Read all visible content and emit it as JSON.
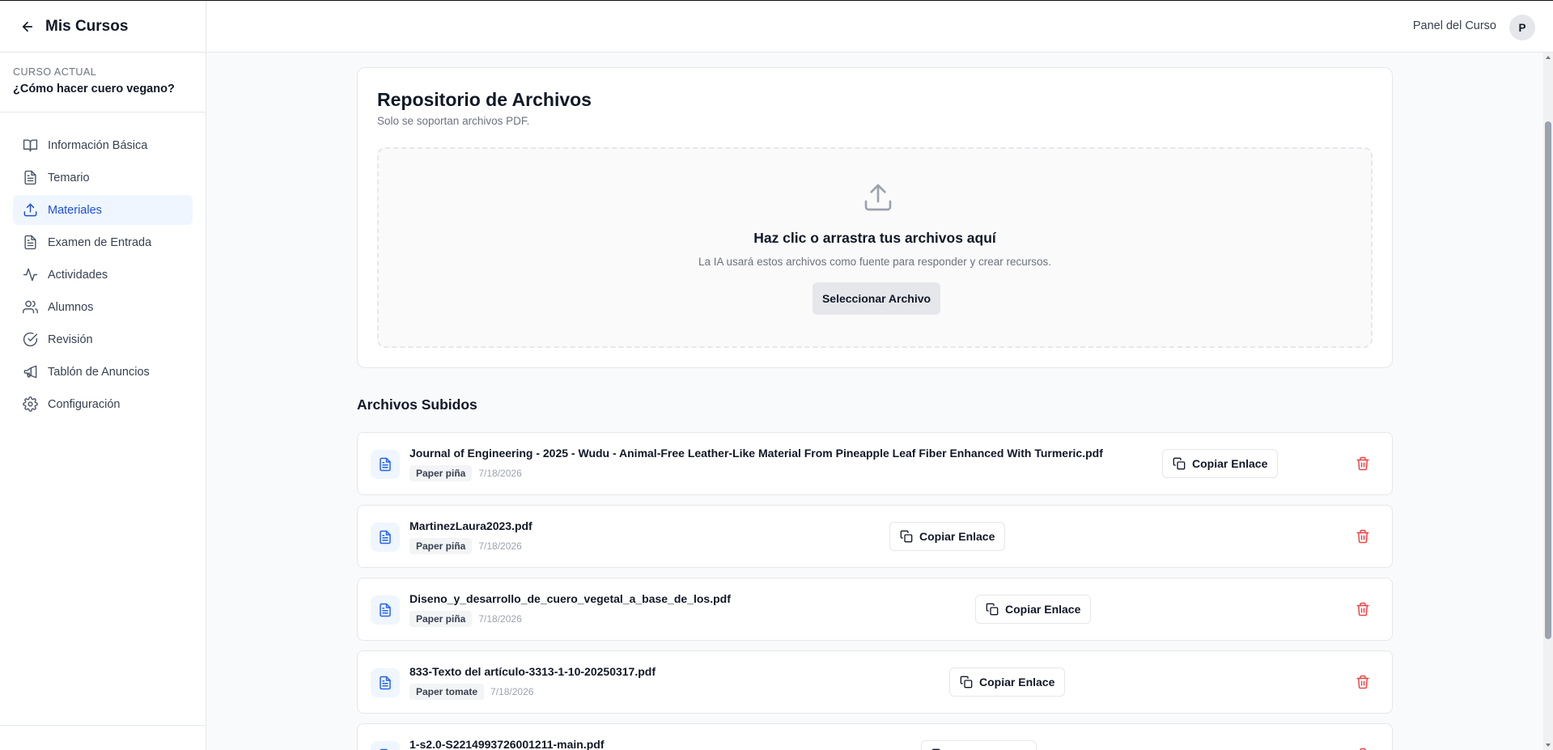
{
  "sidebar": {
    "title": "Mis Cursos",
    "course_label": "CURSO ACTUAL",
    "course_name": "¿Cómo hacer cuero vegano?",
    "items": [
      {
        "label": "Información Básica",
        "icon": "book-open-icon"
      },
      {
        "label": "Temario",
        "icon": "document-icon"
      },
      {
        "label": "Materiales",
        "icon": "upload-icon",
        "active": true
      },
      {
        "label": "Examen de Entrada",
        "icon": "document-icon"
      },
      {
        "label": "Actividades",
        "icon": "activity-icon"
      },
      {
        "label": "Alumnos",
        "icon": "users-icon"
      },
      {
        "label": "Revisión",
        "icon": "check-circle-icon"
      },
      {
        "label": "Tablón de Anuncios",
        "icon": "megaphone-icon"
      },
      {
        "label": "Configuración",
        "icon": "gear-icon"
      }
    ]
  },
  "header": {
    "panel_label": "Panel del Curso",
    "avatar_initial": "P"
  },
  "repository": {
    "title": "Repositorio de Archivos",
    "subtitle": "Solo se soportan archivos PDF.",
    "dropzone_title": "Haz clic o arrastra tus archivos aquí",
    "dropzone_subtitle": "La IA usará estos archivos como fuente para responder y crear recursos.",
    "select_button": "Seleccionar Archivo"
  },
  "uploaded": {
    "title": "Archivos Subidos",
    "copy_label": "Copiar Enlace",
    "files": [
      {
        "name": "Journal of Engineering - 2025 - Wudu - Animal-Free Leather-Like Material From Pineapple Leaf Fiber Enhanced With Turmeric.pdf",
        "tag": "Paper piña",
        "date": "7/18/2026"
      },
      {
        "name": "MartinezLaura2023.pdf",
        "tag": "Paper piña",
        "date": "7/18/2026"
      },
      {
        "name": "Diseno_y_desarrollo_de_cuero_vegetal_a_base_de_los.pdf",
        "tag": "Paper piña",
        "date": "7/18/2026"
      },
      {
        "name": "833-Texto del artículo-3313-1-10-20250317.pdf",
        "tag": "Paper tomate",
        "date": "7/18/2026"
      },
      {
        "name": "1-s2.0-S2214993726001211-main.pdf",
        "tag": "",
        "date": ""
      }
    ]
  },
  "colors": {
    "accent": "#1d4ed8",
    "active_bg": "#eff6ff",
    "danger": "#ef4444"
  }
}
